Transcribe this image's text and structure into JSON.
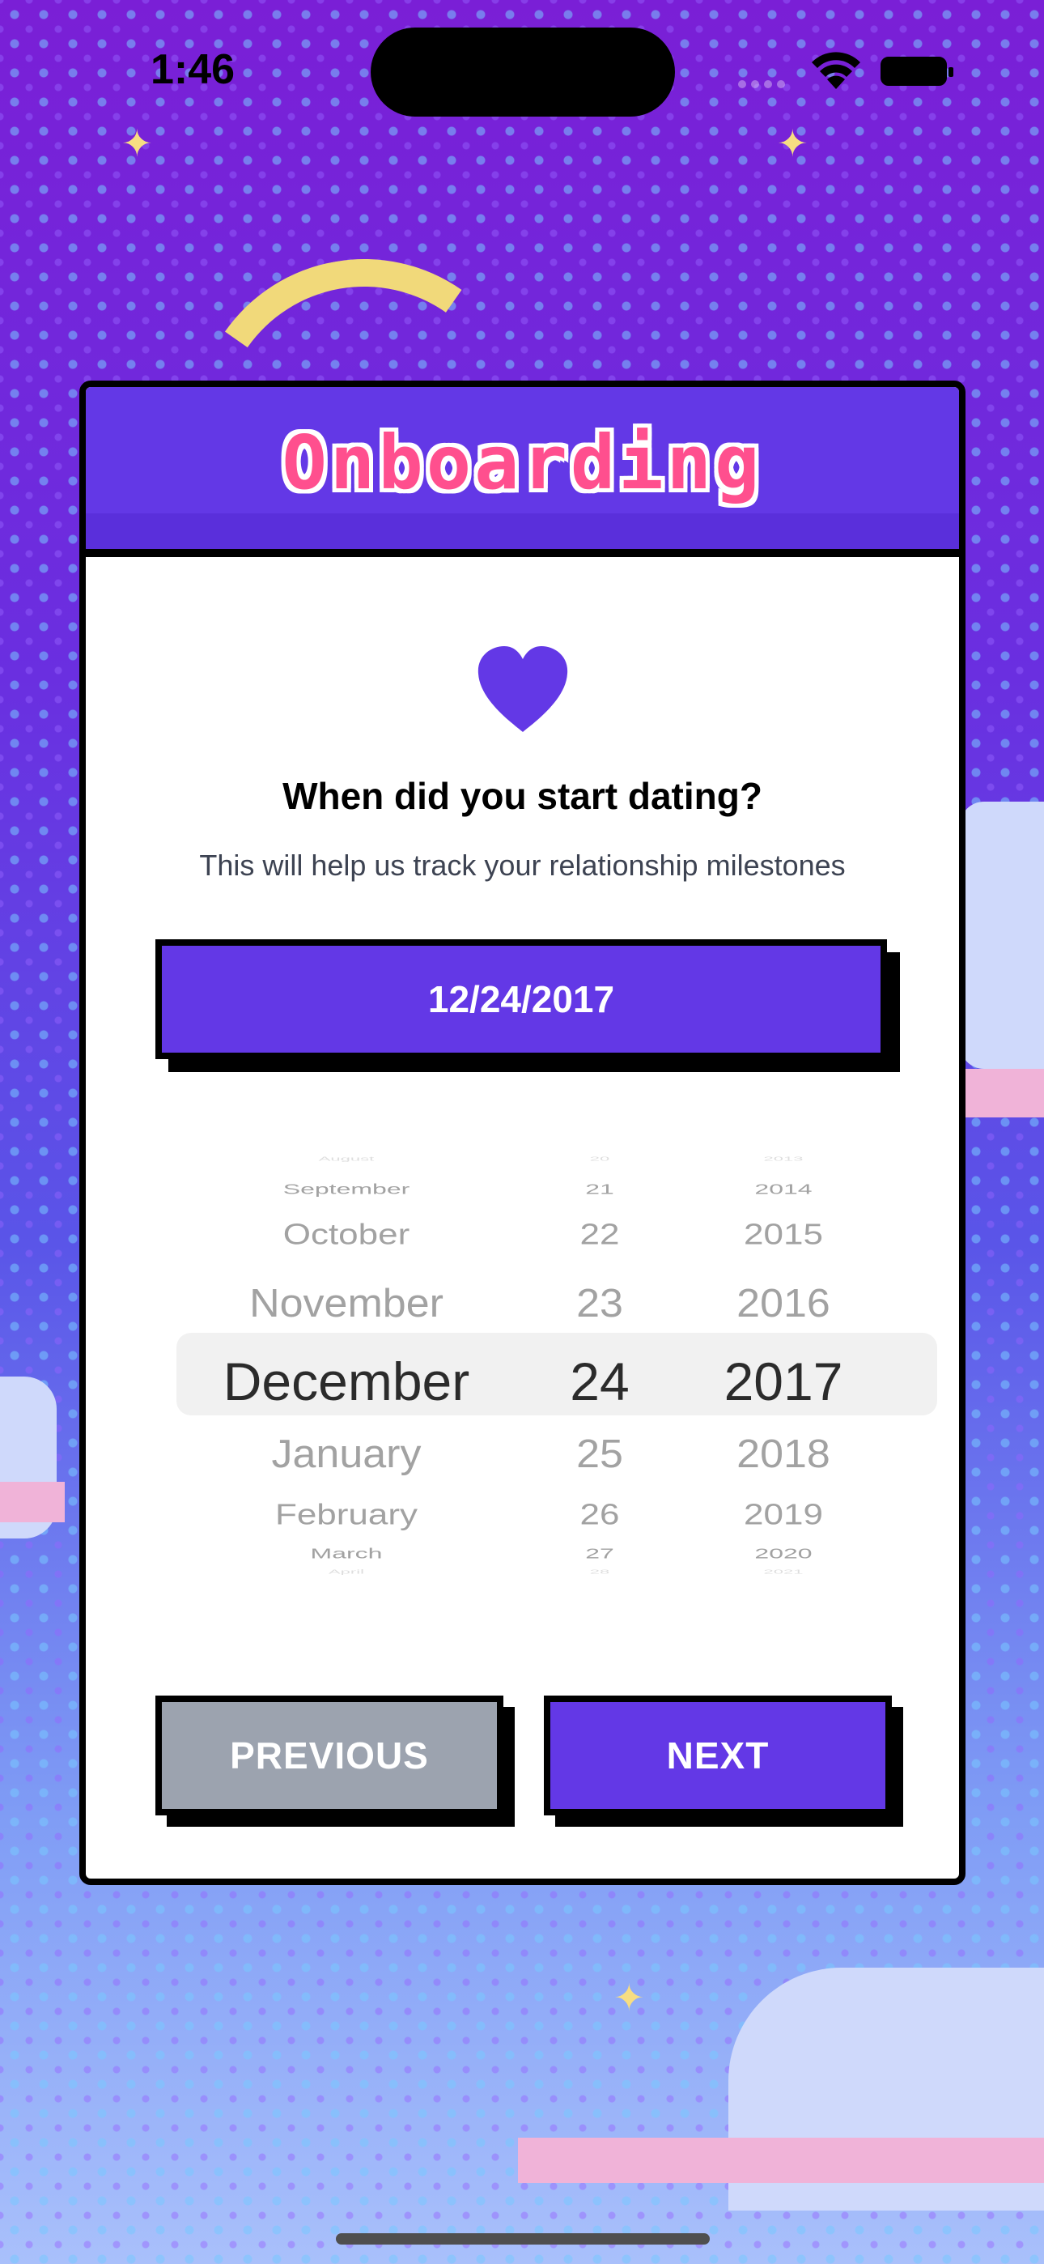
{
  "status_bar": {
    "time": "1:46",
    "icons": [
      "wifi-icon",
      "battery-icon"
    ]
  },
  "background": {
    "decorations": [
      "moon-icon",
      "sparkle-icon",
      "cloud-icon"
    ]
  },
  "card": {
    "title": "Onboarding",
    "icon": "heart-icon",
    "question": "When did you start dating?",
    "subtitle": "This will help us track your relationship milestones",
    "selected_date": "12/24/2017"
  },
  "picker": {
    "months": [
      "August",
      "September",
      "October",
      "November",
      "December",
      "January",
      "February",
      "March",
      "April"
    ],
    "days": [
      "20",
      "21",
      "22",
      "23",
      "24",
      "25",
      "26",
      "27",
      "28"
    ],
    "years": [
      "2013",
      "2014",
      "2015",
      "2016",
      "2017",
      "2018",
      "2019",
      "2020",
      "2021"
    ],
    "selected_index": 4
  },
  "buttons": {
    "previous_label": "PREVIOUS",
    "next_label": "NEXT"
  },
  "colors": {
    "accent": "#6338e6",
    "title_pink": "#ff4f8e",
    "disabled_gray": "#9ca3af"
  }
}
